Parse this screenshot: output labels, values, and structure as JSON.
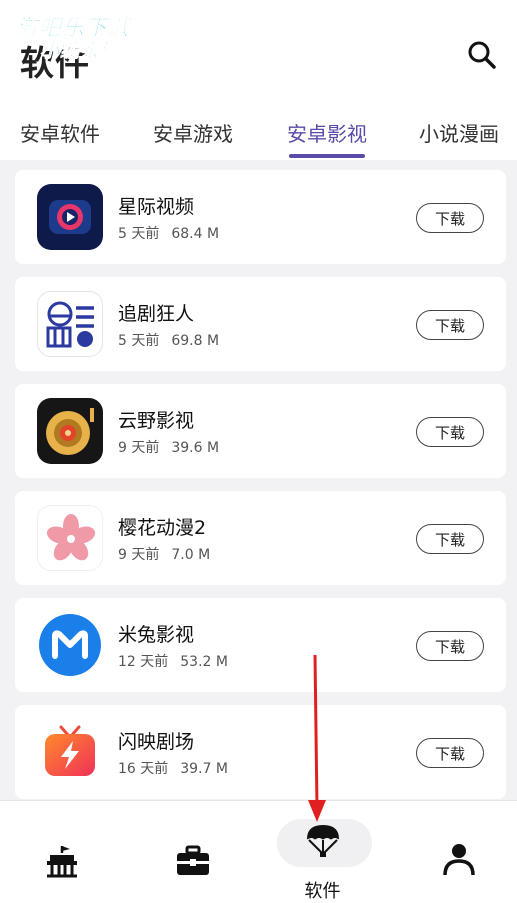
{
  "header": {
    "title": "软件",
    "watermark_line1": "游吧乐下载",
    "watermark_line2": "小编亲测"
  },
  "tabs": [
    {
      "label": "安卓软件",
      "active": false
    },
    {
      "label": "安卓游戏",
      "active": false
    },
    {
      "label": "安卓影视",
      "active": true
    },
    {
      "label": "小说漫画",
      "active": false
    }
  ],
  "apps": [
    {
      "name": "星际视频",
      "age": "5 天前",
      "size": "68.4 M",
      "download_label": "下载",
      "icon": "star-video-icon"
    },
    {
      "name": "追剧狂人",
      "age": "5 天前",
      "size": "69.8 M",
      "download_label": "下载",
      "icon": "drama-fan-icon"
    },
    {
      "name": "云野影视",
      "age": "9 天前",
      "size": "39.6 M",
      "download_label": "下载",
      "icon": "vinyl-record-icon"
    },
    {
      "name": "樱花动漫2",
      "age": "9 天前",
      "size": "7.0 M",
      "download_label": "下载",
      "icon": "sakura-flower-icon"
    },
    {
      "name": "米兔影视",
      "age": "12 天前",
      "size": "53.2 M",
      "download_label": "下载",
      "icon": "m-logo-icon"
    },
    {
      "name": "闪映剧场",
      "age": "16 天前",
      "size": "39.7 M",
      "download_label": "下载",
      "icon": "lightning-tv-icon"
    }
  ],
  "bottom_nav": [
    {
      "label": "",
      "icon": "home-building-icon",
      "active": false
    },
    {
      "label": "",
      "icon": "toolbox-icon",
      "active": false
    },
    {
      "label": "软件",
      "icon": "parachute-icon",
      "active": true
    },
    {
      "label": "",
      "icon": "user-icon",
      "active": false
    }
  ],
  "colors": {
    "accent": "#5b4aa8",
    "annotation": "#e02020",
    "watermark": "#36c6e8"
  }
}
